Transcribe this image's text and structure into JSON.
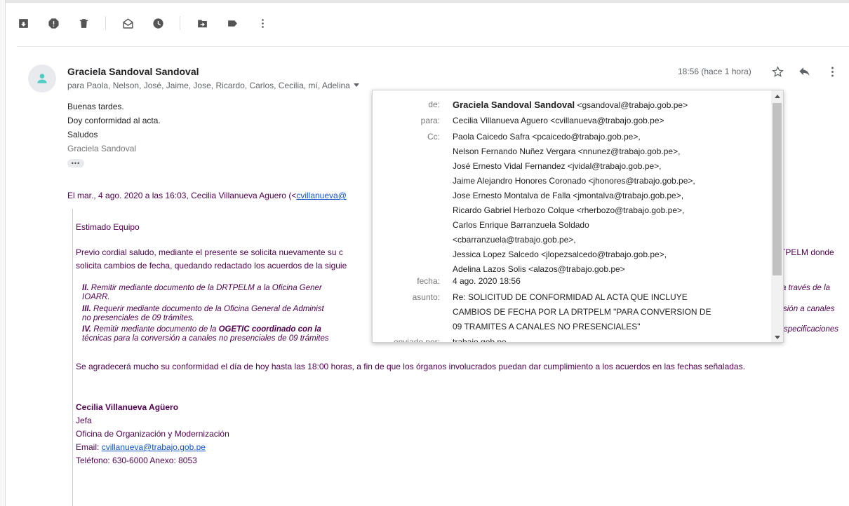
{
  "toolbar": {
    "icons": [
      "archive-icon",
      "report-spam-icon",
      "delete-icon",
      "mark-unread-icon",
      "snooze-icon",
      "move-to-icon",
      "label-icon",
      "more-vert-icon"
    ]
  },
  "message": {
    "sender": "Graciela Sandoval Sandoval",
    "recipients": "para Paola, Nelson, José, Jaime, Jose, Ricardo, Carlos, Cecilia, mí, Adelina",
    "time": "18:56 (hace 1 hora)",
    "body": [
      "Buenas tardes.",
      "Doy conformidad al acta.",
      "Saludos"
    ],
    "signature": "Graciela Sandoval",
    "ellipsis": "•••"
  },
  "quote": {
    "header_prefix": "El mar., 4 ago. 2020 a las 16:03, Cecilia Villanueva Aguero (<",
    "header_link": "cvillanueva@",
    "greeting": "Estimado Equipo",
    "para1_left": " Previo cordial saludo, mediante el presente se solicita nuevamente su c",
    "para1_right": "TPELM donde",
    "para1_line2": "solicita cambios de fecha, quedando redactado los acuerdos de la siguie",
    "items": [
      {
        "num": "II.",
        "text": " Remitir mediante documento de la DRTPELM a la Oficina Gener",
        "right": "a través de la",
        "cont": "IOARR."
      },
      {
        "num": "III.",
        "text": " Requerir mediante documento de la Oficina General de Administ",
        "right": "sión a canales",
        "cont": "no presenciales de 09 trámites."
      },
      {
        "num": "IV.",
        "text": " Remitir mediante documento de la ",
        "bold": "OGETIC coordinado con la",
        "right": "specificaciones",
        "cont": "técnicas para la conversión a canales no presenciales de 09 trámites"
      }
    ],
    "closing": "Se agradecerá mucho su conformidad el día de hoy hasta las 18:00 horas, a fin de que los órganos involucrados puedan dar cumplimiento a los acuerdos en las fechas señaladas.",
    "sig_name": "Cecilia Villanueva Agüero",
    "sig_title": "Jefa",
    "sig_office": "Oficina de Organización y Modernización",
    "sig_email_label": "Email: ",
    "sig_email": "cvillanueva@trabajo.gob.pe",
    "sig_phone": "Teléfono: 630-6000 Anexo: 8053"
  },
  "details_popup": {
    "from_label": "de:",
    "from_name": "Graciela Sandoval Sandoval",
    "from_email": " <gsandoval@trabajo.gob.pe>",
    "to_label": "para:",
    "to_value": "Cecilia Villanueva Aguero <cvillanueva@trabajo.gob.pe>",
    "cc_label": "Cc:",
    "cc_lines": [
      "Paola Caicedo Safra <pcaicedo@trabajo.gob.pe>,",
      "Nelson Fernando Nuñez Vergara <nnunez@trabajo.gob.pe>,",
      "José Ernesto Vidal Fernandez <jvidal@trabajo.gob.pe>,",
      "Jaime Alejandro Honores Coronado <jhonores@trabajo.gob.pe>,",
      "Jose Ernesto Montalva de Falla <jmontalva@trabajo.gob.pe>,",
      "Ricardo Gabriel Herbozo Colque <rherbozo@trabajo.gob.pe>,",
      "Carlos Enrique Barranzuela Soldado",
      "<cbarranzuela@trabajo.gob.pe>,",
      "Jessica Lopez Salcedo <jlopezsalcedo@trabajo.gob.pe>,",
      "Adelina Lazos Solis <alazos@trabajo.gob.pe>"
    ],
    "date_label": "fecha:",
    "date_value": "4 ago. 2020 18:56",
    "subject_label": "asunto:",
    "subject_lines": [
      "Re: SOLICITUD DE CONFORMIDAD AL ACTA QUE INCLUYE",
      "CAMBIOS DE FECHA POR LA DRTPELM \"PARA CONVERSION DE",
      "09 TRAMITES A CANALES NO PRESENCIALES\""
    ],
    "sent_label": "enviado por:",
    "sent_value": "trabajo.gob.pe"
  }
}
